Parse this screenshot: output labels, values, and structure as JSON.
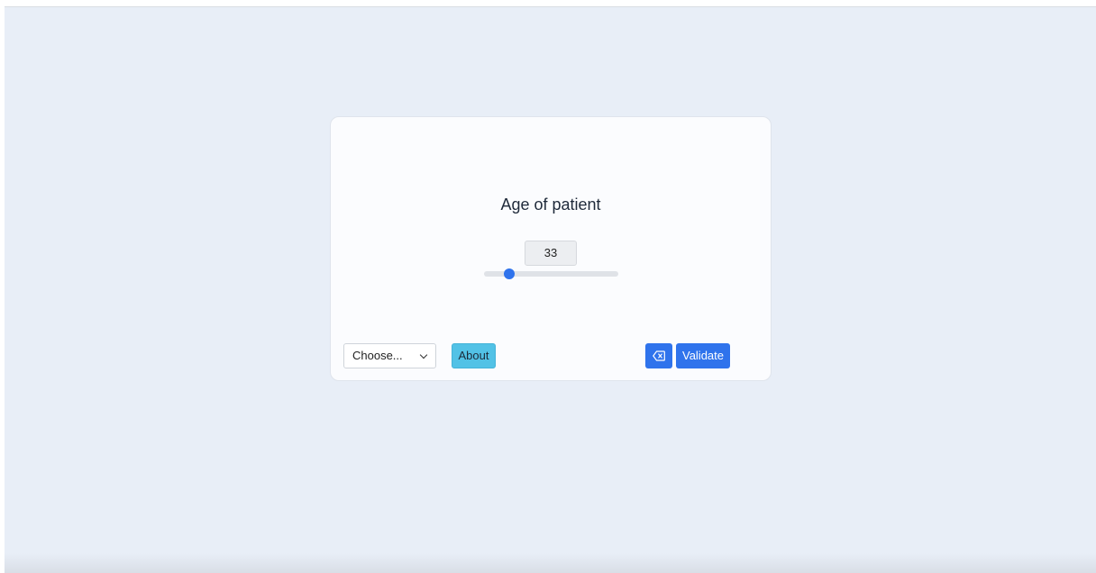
{
  "question": {
    "title": "Age of patient"
  },
  "slider": {
    "value": "33",
    "fraction": 0.19
  },
  "footer": {
    "select_label": "Choose...",
    "about_label": "About",
    "validate_label": "Validate"
  },
  "colors": {
    "background": "#e8eef7",
    "primary": "#2f73ec",
    "info": "#52c2e6"
  },
  "icons": {
    "clear": "backspace-icon",
    "select": "chevron-down-icon"
  }
}
